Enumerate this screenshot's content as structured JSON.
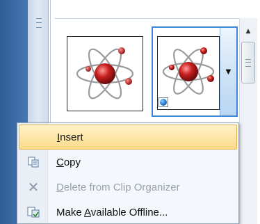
{
  "gallery": {
    "items": [
      {
        "icon": "atom-clipart-icon",
        "selected": false
      },
      {
        "icon": "atom-clipart-icon",
        "selected": true,
        "badge": "globe-icon"
      }
    ]
  },
  "context_menu": {
    "items": [
      {
        "pre": "",
        "key": "I",
        "post": "nsert",
        "icon": "",
        "highlighted": true,
        "enabled": true
      },
      {
        "pre": "",
        "key": "C",
        "post": "opy",
        "icon": "copy-icon",
        "highlighted": false,
        "enabled": true
      },
      {
        "pre": "",
        "key": "D",
        "post": "elete from Clip Organizer",
        "icon": "delete-x-icon",
        "highlighted": false,
        "enabled": false
      },
      {
        "pre": "Make ",
        "key": "A",
        "post": "vailable Offline...",
        "icon": "offline-icon",
        "highlighted": false,
        "enabled": true
      }
    ]
  },
  "colors": {
    "highlight": "#fbdb8a",
    "selection_border": "#3d86d6",
    "ribbon_blue": "#2e5c94"
  }
}
